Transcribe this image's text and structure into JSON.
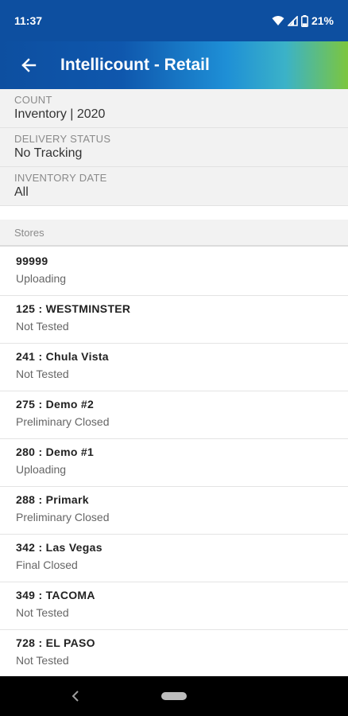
{
  "status_bar": {
    "time": "11:37",
    "battery": "21%"
  },
  "app_bar": {
    "title": "Intellicount - Retail"
  },
  "filters": [
    {
      "label": "COUNT",
      "value": "Inventory | 2020"
    },
    {
      "label": "DELIVERY STATUS",
      "value": "No Tracking"
    },
    {
      "label": "INVENTORY DATE",
      "value": "All"
    }
  ],
  "stores_section": {
    "header": "Stores"
  },
  "stores": [
    {
      "name": "99999",
      "status": "Uploading"
    },
    {
      "name": "125 : WESTMINSTER",
      "status": "Not Tested"
    },
    {
      "name": "241 : Chula Vista",
      "status": "Not Tested"
    },
    {
      "name": "275 : Demo #2",
      "status": "Preliminary Closed"
    },
    {
      "name": "280 : Demo #1",
      "status": "Uploading"
    },
    {
      "name": "288 : Primark",
      "status": "Preliminary Closed"
    },
    {
      "name": "342 : Las Vegas",
      "status": "Final Closed"
    },
    {
      "name": "349 : TACOMA",
      "status": "Not Tested"
    },
    {
      "name": "728 : EL PASO",
      "status": "Not Tested"
    }
  ],
  "colors": {
    "status_bar_bg": "#0d4fa0",
    "gradient_start": "#0d4fa0",
    "gradient_end": "#7cc63e",
    "filter_bg": "#f2f2f2"
  },
  "icons": {
    "status_bar": [
      "wifi-icon",
      "signal-icon",
      "battery-icon"
    ],
    "app_bar": "back-arrow-icon",
    "nav_bar": [
      "nav-back-icon",
      "home-pill-icon"
    ]
  }
}
